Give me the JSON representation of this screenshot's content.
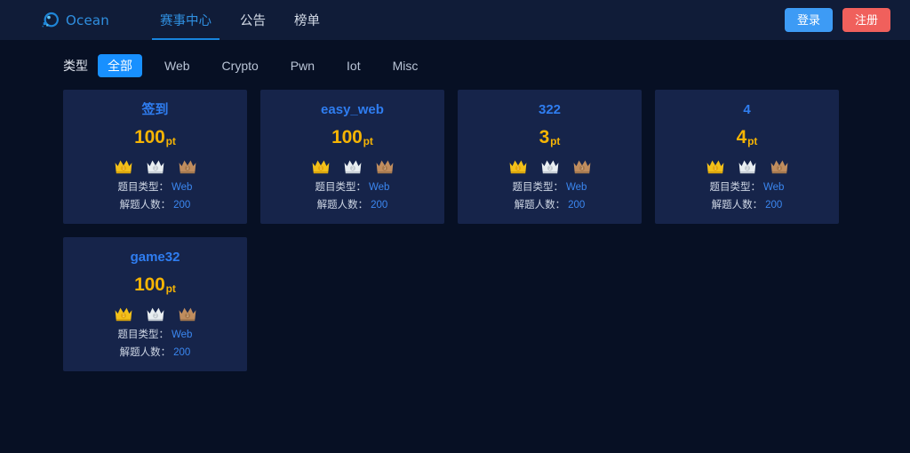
{
  "header": {
    "brand": {
      "logo_icon": "ocean-circle-logo",
      "name": "Ocean"
    },
    "nav": [
      {
        "label": "赛事中心",
        "active": true
      },
      {
        "label": "公告",
        "active": false
      },
      {
        "label": "榜单",
        "active": false
      }
    ],
    "actions": {
      "login_label": "登录",
      "signup_label": "注册"
    },
    "colors": {
      "bar_bg": "#101c38",
      "brand": "#2f8fe0",
      "active_nav": "#2f8fe0",
      "underline": "#1784dd",
      "login_bg": "#3d9bf5",
      "signup_bg": "#f0605c"
    }
  },
  "filter": {
    "label": "类型",
    "active_color": "#1890ff",
    "chips": [
      {
        "label": "全部",
        "active": true
      },
      {
        "label": "Web",
        "active": false
      },
      {
        "label": "Crypto",
        "active": false
      },
      {
        "label": "Pwn",
        "active": false
      },
      {
        "label": "Iot",
        "active": false
      },
      {
        "label": "Misc",
        "active": false
      }
    ]
  },
  "challenges": {
    "meta_labels": {
      "category": "题目类型：",
      "solves": "解题人数："
    },
    "point_unit": "pt",
    "rank_icons": [
      "gold-crown-icon",
      "silver-crown-icon",
      "bronze-crown-icon"
    ],
    "colors": {
      "card_bg": "#16244a",
      "title": "#2f7df0",
      "points": "#f6b404",
      "meta_key": "#cfd7e5",
      "meta_value": "#3b87f0"
    },
    "items": [
      {
        "title": "签到",
        "points": "100",
        "category": "Web",
        "solves": "200"
      },
      {
        "title": "easy_web",
        "points": "100",
        "category": "Web",
        "solves": "200"
      },
      {
        "title": "322",
        "points": "3",
        "category": "Web",
        "solves": "200"
      },
      {
        "title": "4",
        "points": "4",
        "category": "Web",
        "solves": "200"
      },
      {
        "title": "game32",
        "points": "100",
        "category": "Web",
        "solves": "200"
      }
    ]
  },
  "page": {
    "background": "#071024"
  }
}
